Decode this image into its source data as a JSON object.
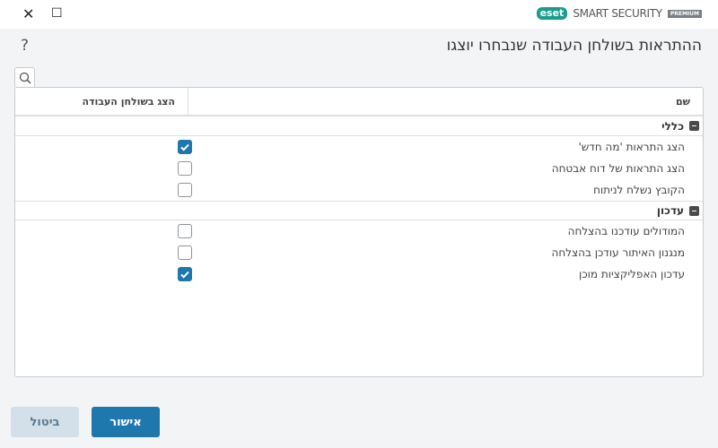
{
  "window": {
    "close": "✕",
    "maximize": "☐"
  },
  "brand": {
    "logo": "eset",
    "product": "SMART SECURITY",
    "edition": "PREMIUM"
  },
  "title": "ההתראות בשולחן העבודה שנבחרו יוצגו",
  "help": "?",
  "table": {
    "columns": [
      "שם",
      "הצג בשולחן העבודה"
    ],
    "groups": [
      {
        "name": "כללי",
        "items": [
          {
            "label": "הצג התראות 'מה חדש'",
            "checked": true
          },
          {
            "label": "הצג התראות של דוח אבטחה",
            "checked": false
          },
          {
            "label": "הקובץ נשלח לניתוח",
            "checked": false
          }
        ]
      },
      {
        "name": "עדכון",
        "items": [
          {
            "label": "המודולים עודכנו בהצלחה",
            "checked": false
          },
          {
            "label": "מנגנון האיתור עודכן בהצלחה",
            "checked": false
          },
          {
            "label": "עדכון האפליקציות מוכן",
            "checked": true
          }
        ]
      }
    ]
  },
  "buttons": {
    "ok": "אישור",
    "cancel": "ביטול"
  },
  "colors": {
    "accent": "#1e77ad",
    "brand": "#1a9c8e"
  }
}
